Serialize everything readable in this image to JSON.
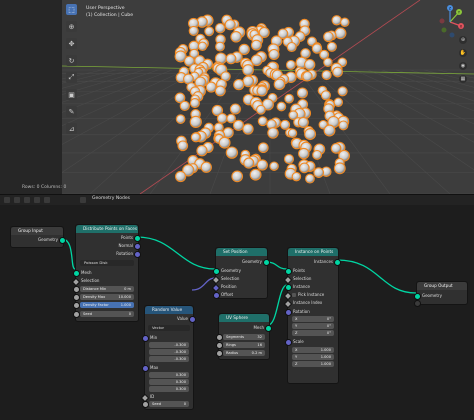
{
  "viewport": {
    "title_line1": "User Perspective",
    "title_line2": "(1) Collection | Cube",
    "rows_info": "Rows: 0   Columns: 0",
    "tools": [
      "select-box",
      "cursor",
      "move",
      "rotate",
      "scale",
      "transform",
      "annotate",
      "measure"
    ],
    "gizmo": {
      "x": "X",
      "y": "Y",
      "z": "Z"
    },
    "colors": {
      "bg": "#3d3d3d",
      "grid": "#4a4a4a",
      "x_axis": "#b34a52",
      "y_axis": "#7ba83a",
      "sphere": "#c9c9c9",
      "sphere_outline": "#f08a24"
    }
  },
  "node_editor": {
    "title": "Geometry Nodes"
  },
  "nodes": {
    "group_input": {
      "title": "Group Input",
      "geometry": "Geometry"
    },
    "distribute": {
      "title": "Distribute Points on Faces",
      "points": "Points",
      "normal": "Normal",
      "rotation": "Rotation",
      "mode": "Poisson Disk",
      "mesh": "Mesh",
      "selection": "Selection",
      "distance_min_label": "Distance Min",
      "distance_min": "0 m",
      "density_max_label": "Density Max",
      "density_max": "10.000",
      "density_factor_label": "Density Factor",
      "density_factor": "1.000",
      "seed_label": "Seed",
      "seed": "0"
    },
    "random_value": {
      "title": "Random Value",
      "value": "Value",
      "type": "Vector",
      "min": "Min",
      "min_x": "-0.300",
      "min_y": "-0.300",
      "min_z": "-0.300",
      "max": "Max",
      "max_x": "0.300",
      "max_y": "0.300",
      "max_z": "0.300",
      "id": "ID",
      "seed_label": "Seed",
      "seed": "0"
    },
    "set_position": {
      "title": "Set Position",
      "geometry_out": "Geometry",
      "geometry": "Geometry",
      "selection": "Selection",
      "position": "Position",
      "offset": "Offset"
    },
    "uv_sphere": {
      "title": "UV Sphere",
      "mesh": "Mesh",
      "segments_label": "Segments",
      "segments": "32",
      "rings_label": "Rings",
      "rings": "16",
      "radius_label": "Radius",
      "radius": "0.2 m"
    },
    "instance_on_points": {
      "title": "Instance on Points",
      "instances": "Instances",
      "points": "Points",
      "selection": "Selection",
      "instance": "Instance",
      "pick_instance": "Pick Instance",
      "instance_index": "Instance Index",
      "rotation": "Rotation",
      "rot_x_label": "X",
      "rot_x": "0°",
      "rot_y_label": "Y",
      "rot_y": "0°",
      "rot_z_label": "Z",
      "rot_z": "0°",
      "scale": "Scale",
      "scale_x_label": "X",
      "scale_x": "1.000",
      "scale_y_label": "Y",
      "scale_y": "1.000",
      "scale_z_label": "Z",
      "scale_z": "1.000"
    },
    "group_output": {
      "title": "Group Output",
      "geometry": "Geometry"
    }
  },
  "colors": {
    "geometry_socket": "#00d6a3",
    "vector_socket": "#6363c7",
    "value_socket": "#a1a1a1",
    "input_header": "#3b3b3b",
    "geo_header": "#1f6f69",
    "util_header": "#26557a",
    "mesh_header": "#1f6f69",
    "output_header": "#3b3b3b"
  }
}
